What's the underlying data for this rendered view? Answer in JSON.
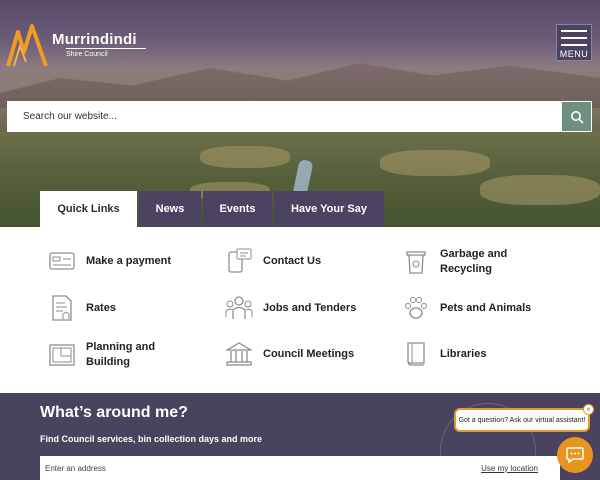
{
  "header": {
    "logo_name": "Murrindindi",
    "logo_sub": "Shire Council",
    "menu_label": "MENU"
  },
  "search": {
    "placeholder": "Search our website..."
  },
  "tabs": [
    {
      "label": "Quick Links",
      "active": true
    },
    {
      "label": "News",
      "active": false
    },
    {
      "label": "Events",
      "active": false
    },
    {
      "label": "Have Your Say",
      "active": false
    }
  ],
  "quick_links": [
    {
      "label": "Make a payment",
      "icon": "payment-card-icon"
    },
    {
      "label": "Contact Us",
      "icon": "contact-phone-icon"
    },
    {
      "label": "Garbage and Recycling",
      "icon": "bin-icon"
    },
    {
      "label": "Rates",
      "icon": "rates-document-icon"
    },
    {
      "label": "Jobs and Tenders",
      "icon": "people-icon"
    },
    {
      "label": "Pets and Animals",
      "icon": "paw-icon"
    },
    {
      "label": "Planning and Building",
      "icon": "floor-plan-icon"
    },
    {
      "label": "Council Meetings",
      "icon": "building-icon"
    },
    {
      "label": "Libraries",
      "icon": "book-icon"
    }
  ],
  "around": {
    "title": "What’s around me?",
    "description": "Find Council services, bin collection days and more",
    "address_placeholder": "Enter an address",
    "use_location": "Use my location"
  },
  "chat": {
    "bubble_text": "Got a question? Ask our virtual assistant!",
    "close": "×"
  },
  "colors": {
    "brand_purple": "#4b4361",
    "search_green": "#6f8f7e",
    "icon_grey": "#8a8f8c",
    "chat_orange": "#e8951f"
  }
}
